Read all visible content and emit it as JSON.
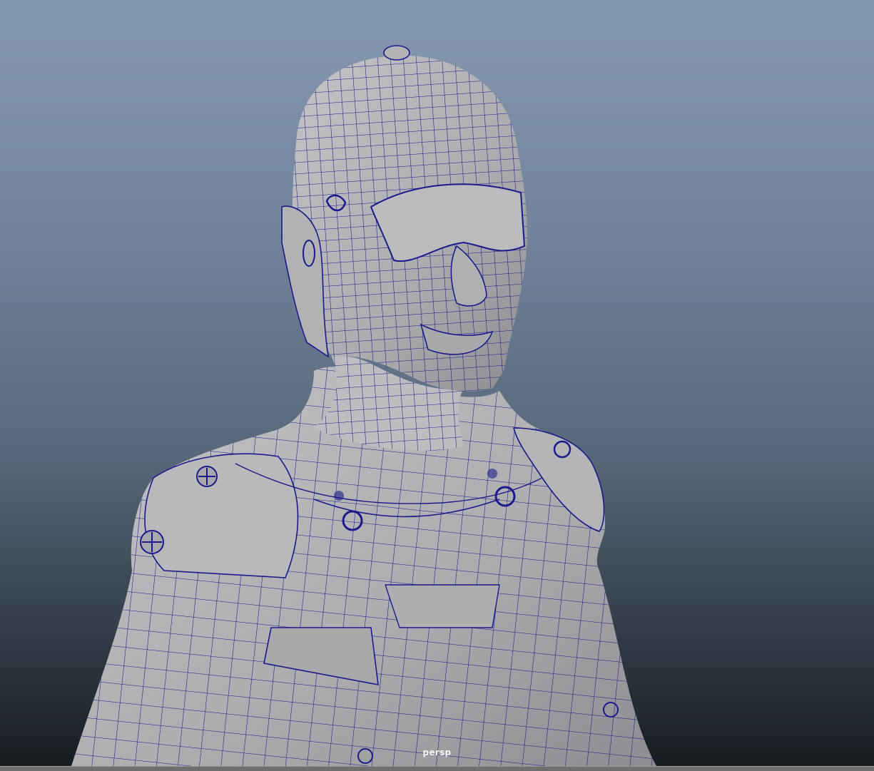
{
  "viewport": {
    "camera_name": "persp",
    "background_top": "#8599b1",
    "background_bottom": "#181c21"
  },
  "mesh": {
    "shaded_color": "#b3b3b6",
    "wireframe_color": "#1c1a8a",
    "display_mode": "wireframe-on-shaded"
  }
}
